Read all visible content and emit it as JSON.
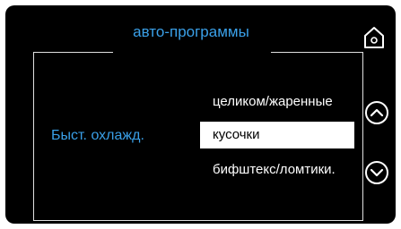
{
  "header": {
    "title": "авто-программы"
  },
  "mode": {
    "label": "Быст. охлажд."
  },
  "options": [
    {
      "label": "целиком/жаренные",
      "selected": false
    },
    {
      "label": "кусочки",
      "selected": true
    },
    {
      "label": "бифштекс/ломтики.",
      "selected": false
    }
  ],
  "icons": {
    "home": "home-icon",
    "up": "chevron-up-circle-icon",
    "down": "chevron-down-circle-icon"
  },
  "colors": {
    "background": "#000000",
    "accent": "#3aa0e8",
    "text": "#ffffff",
    "selection_bg": "#ffffff",
    "selection_text": "#000000"
  }
}
